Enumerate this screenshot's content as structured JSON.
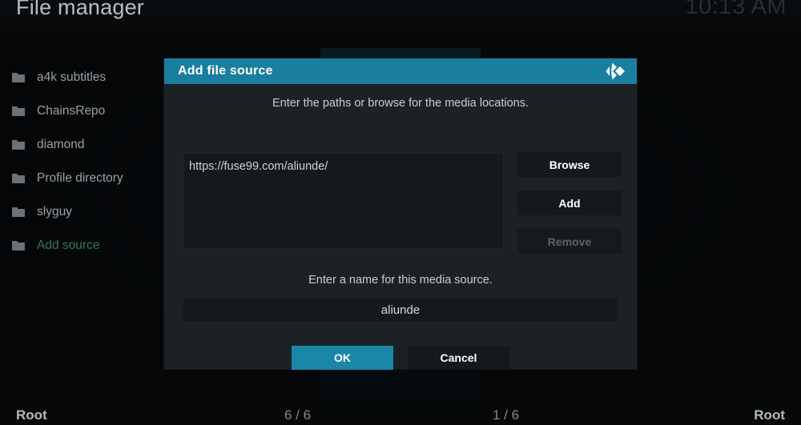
{
  "header": {
    "title": "File manager",
    "clock": "10:13 AM"
  },
  "sidebar": {
    "items": [
      {
        "label": "a4k subtitles",
        "icon": "folder-icon",
        "active": false
      },
      {
        "label": "ChainsRepo",
        "icon": "folder-icon",
        "active": false
      },
      {
        "label": "diamond",
        "icon": "folder-icon",
        "active": false
      },
      {
        "label": "Profile directory",
        "icon": "folder-icon",
        "active": false
      },
      {
        "label": "slyguy",
        "icon": "folder-icon",
        "active": false
      },
      {
        "label": "Add source",
        "icon": "folder-icon",
        "active": true
      }
    ]
  },
  "dialog": {
    "title": "Add file source",
    "logo_icon": "kodi-logo-icon",
    "paths_hint": "Enter the paths or browse for the media locations.",
    "paths": [
      "https://fuse99.com/aliunde/"
    ],
    "buttons": {
      "browse": "Browse",
      "add": "Add",
      "remove": "Remove"
    },
    "name_hint": "Enter a name for this media source.",
    "name_value": "aliunde",
    "ok": "OK",
    "cancel": "Cancel"
  },
  "status_bar": {
    "left": "Root",
    "left_count": "6 / 6",
    "right_count": "1 / 6",
    "right": "Root"
  },
  "colors": {
    "accent": "#1a7e9e",
    "accent_focus": "#1a86a8",
    "active_item": "#2f7d51",
    "dialog_bg": "#1b2125",
    "field_bg": "#14191c"
  }
}
